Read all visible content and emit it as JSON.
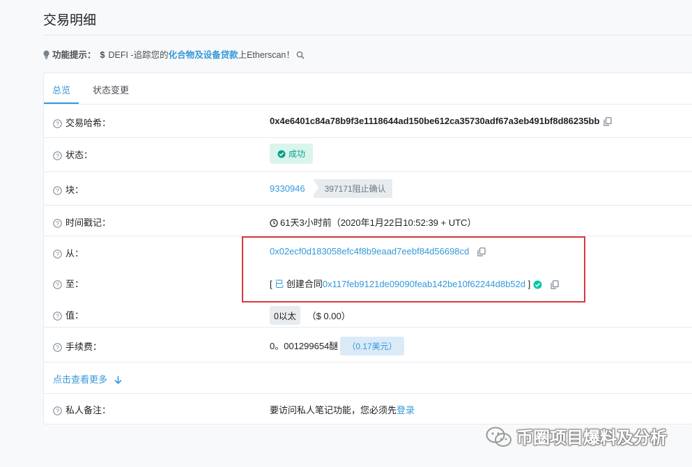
{
  "page": {
    "title": "交易明细"
  },
  "hint": {
    "label": "功能提示：",
    "dollar": "$",
    "prefix": "DEFI -追踪您的",
    "link": "化合物及设备贷款",
    "suffix": "上Etherscan！"
  },
  "tabs": [
    {
      "label": "总览",
      "active": true
    },
    {
      "label": "状态变更",
      "active": false
    }
  ],
  "details": {
    "tx_hash_label": "交易哈希：",
    "tx_hash": "0x4e6401c84a78b9f3e1118644ad150be612ca35730adf67a3eb491bf8d86235bb",
    "status_label": "状态：",
    "status": "成功",
    "block_label": "块：",
    "block": "9330946",
    "confirmations": "397171阻止确认",
    "timestamp_label": "时间戳记：",
    "timestamp": "61天3小时前（2020年1月22日10:52:39 + UTC）",
    "from_label": "从：",
    "from": "0x02ecf0d183058efc4f8b9eaad7eebf84d56698cd",
    "to_label": "至：",
    "to_open": "[",
    "to_prefix": "已",
    "to_text": "创建合同",
    "to_address": "0x117feb9121de09090feab142be10f62244d8b52d",
    "to_close": "]",
    "value_label": "值：",
    "value": "0以太",
    "value_usd": "（$ 0.00）",
    "fee_label": "手续费：",
    "fee": "0。001299654醚",
    "fee_usd": "（0.17美元）",
    "more_link": "点击查看更多",
    "note_label": "私人备注：",
    "note_text": "要访问私人笔记功能，您必须先",
    "note_login": "登录"
  },
  "watermark": "币圈项目爆料及分析",
  "colors": {
    "accent": "#3498db",
    "success": "#00a186",
    "highlight": "#d9363e"
  }
}
